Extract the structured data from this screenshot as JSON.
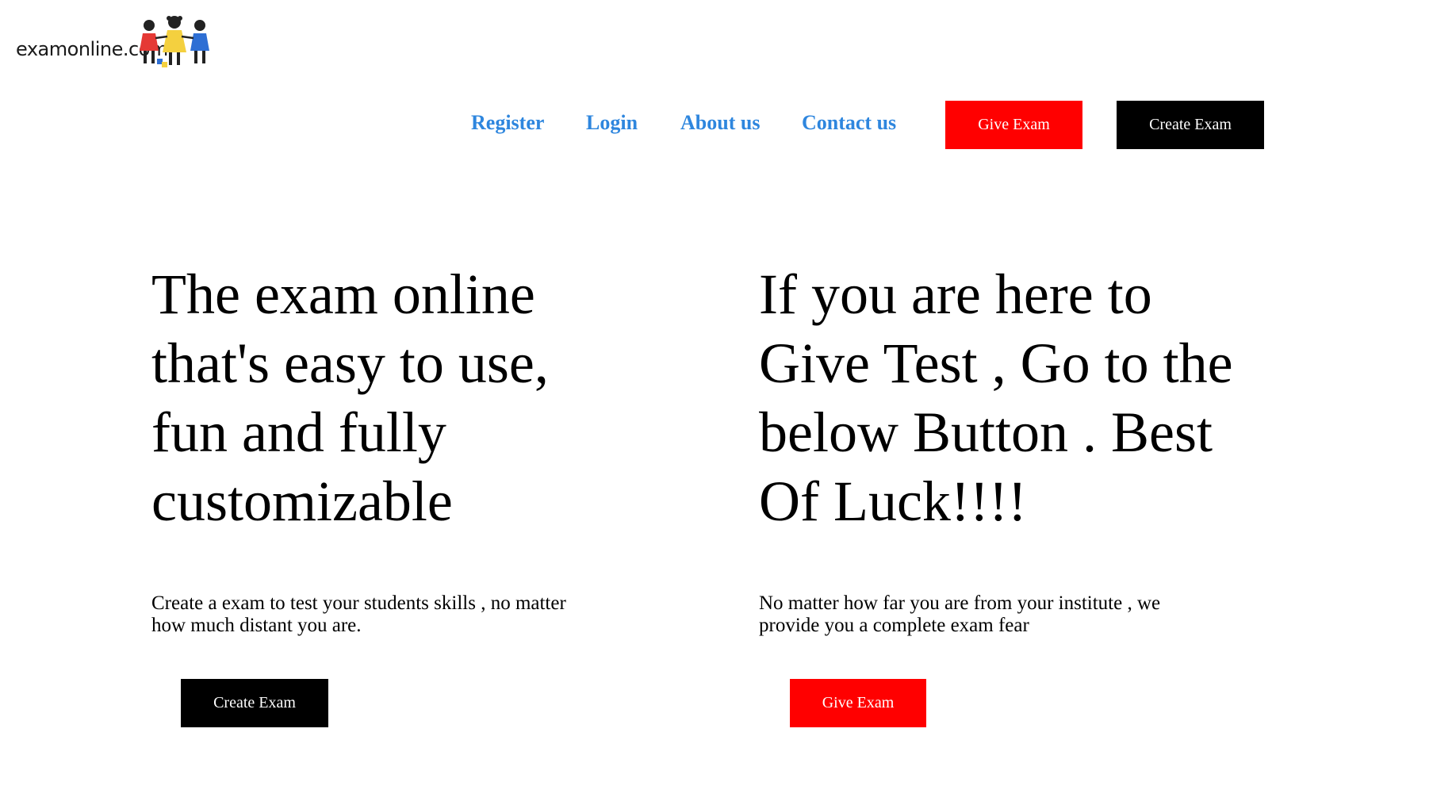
{
  "logo": {
    "text": "examonline.com",
    "icon": "children-holding-hands-logo"
  },
  "nav": {
    "links": [
      {
        "label": "Register"
      },
      {
        "label": "Login"
      },
      {
        "label": "About us"
      },
      {
        "label": "Contact us"
      }
    ],
    "give_exam_label": "Give Exam",
    "create_exam_label": "Create Exam"
  },
  "hero": {
    "left": {
      "heading": "The exam online that's easy to use, fun and fully customizable",
      "paragraph": "Create a exam to test your students skills , no matter how much distant you are.",
      "button_label": "Create Exam"
    },
    "right": {
      "heading": "If you are here to Give Test , Go to the below Button . Best Of Luck!!!!",
      "paragraph": "No matter how far you are from your institute , we provide you a complete exam fear",
      "button_label": "Give Exam"
    }
  },
  "colors": {
    "link": "#2e86de",
    "give_button": "#ff0000",
    "create_button": "#000000",
    "button_text": "#ffffff"
  }
}
